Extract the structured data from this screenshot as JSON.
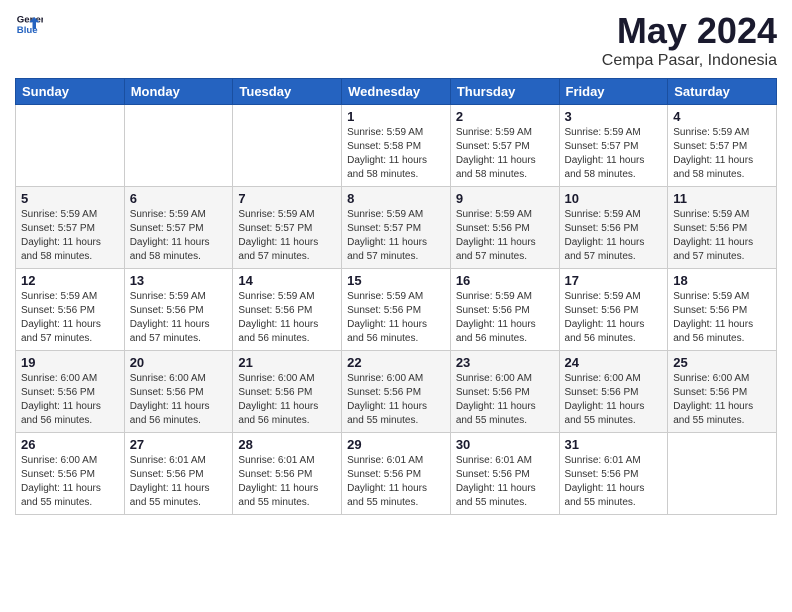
{
  "header": {
    "logo_line1": "General",
    "logo_line2": "Blue",
    "title": "May 2024",
    "subtitle": "Cempa Pasar, Indonesia"
  },
  "weekdays": [
    "Sunday",
    "Monday",
    "Tuesday",
    "Wednesday",
    "Thursday",
    "Friday",
    "Saturday"
  ],
  "weeks": [
    [
      {
        "day": "",
        "info": ""
      },
      {
        "day": "",
        "info": ""
      },
      {
        "day": "",
        "info": ""
      },
      {
        "day": "1",
        "info": "Sunrise: 5:59 AM\nSunset: 5:58 PM\nDaylight: 11 hours\nand 58 minutes."
      },
      {
        "day": "2",
        "info": "Sunrise: 5:59 AM\nSunset: 5:57 PM\nDaylight: 11 hours\nand 58 minutes."
      },
      {
        "day": "3",
        "info": "Sunrise: 5:59 AM\nSunset: 5:57 PM\nDaylight: 11 hours\nand 58 minutes."
      },
      {
        "day": "4",
        "info": "Sunrise: 5:59 AM\nSunset: 5:57 PM\nDaylight: 11 hours\nand 58 minutes."
      }
    ],
    [
      {
        "day": "5",
        "info": "Sunrise: 5:59 AM\nSunset: 5:57 PM\nDaylight: 11 hours\nand 58 minutes."
      },
      {
        "day": "6",
        "info": "Sunrise: 5:59 AM\nSunset: 5:57 PM\nDaylight: 11 hours\nand 58 minutes."
      },
      {
        "day": "7",
        "info": "Sunrise: 5:59 AM\nSunset: 5:57 PM\nDaylight: 11 hours\nand 57 minutes."
      },
      {
        "day": "8",
        "info": "Sunrise: 5:59 AM\nSunset: 5:57 PM\nDaylight: 11 hours\nand 57 minutes."
      },
      {
        "day": "9",
        "info": "Sunrise: 5:59 AM\nSunset: 5:56 PM\nDaylight: 11 hours\nand 57 minutes."
      },
      {
        "day": "10",
        "info": "Sunrise: 5:59 AM\nSunset: 5:56 PM\nDaylight: 11 hours\nand 57 minutes."
      },
      {
        "day": "11",
        "info": "Sunrise: 5:59 AM\nSunset: 5:56 PM\nDaylight: 11 hours\nand 57 minutes."
      }
    ],
    [
      {
        "day": "12",
        "info": "Sunrise: 5:59 AM\nSunset: 5:56 PM\nDaylight: 11 hours\nand 57 minutes."
      },
      {
        "day": "13",
        "info": "Sunrise: 5:59 AM\nSunset: 5:56 PM\nDaylight: 11 hours\nand 57 minutes."
      },
      {
        "day": "14",
        "info": "Sunrise: 5:59 AM\nSunset: 5:56 PM\nDaylight: 11 hours\nand 56 minutes."
      },
      {
        "day": "15",
        "info": "Sunrise: 5:59 AM\nSunset: 5:56 PM\nDaylight: 11 hours\nand 56 minutes."
      },
      {
        "day": "16",
        "info": "Sunrise: 5:59 AM\nSunset: 5:56 PM\nDaylight: 11 hours\nand 56 minutes."
      },
      {
        "day": "17",
        "info": "Sunrise: 5:59 AM\nSunset: 5:56 PM\nDaylight: 11 hours\nand 56 minutes."
      },
      {
        "day": "18",
        "info": "Sunrise: 5:59 AM\nSunset: 5:56 PM\nDaylight: 11 hours\nand 56 minutes."
      }
    ],
    [
      {
        "day": "19",
        "info": "Sunrise: 6:00 AM\nSunset: 5:56 PM\nDaylight: 11 hours\nand 56 minutes."
      },
      {
        "day": "20",
        "info": "Sunrise: 6:00 AM\nSunset: 5:56 PM\nDaylight: 11 hours\nand 56 minutes."
      },
      {
        "day": "21",
        "info": "Sunrise: 6:00 AM\nSunset: 5:56 PM\nDaylight: 11 hours\nand 56 minutes."
      },
      {
        "day": "22",
        "info": "Sunrise: 6:00 AM\nSunset: 5:56 PM\nDaylight: 11 hours\nand 55 minutes."
      },
      {
        "day": "23",
        "info": "Sunrise: 6:00 AM\nSunset: 5:56 PM\nDaylight: 11 hours\nand 55 minutes."
      },
      {
        "day": "24",
        "info": "Sunrise: 6:00 AM\nSunset: 5:56 PM\nDaylight: 11 hours\nand 55 minutes."
      },
      {
        "day": "25",
        "info": "Sunrise: 6:00 AM\nSunset: 5:56 PM\nDaylight: 11 hours\nand 55 minutes."
      }
    ],
    [
      {
        "day": "26",
        "info": "Sunrise: 6:00 AM\nSunset: 5:56 PM\nDaylight: 11 hours\nand 55 minutes."
      },
      {
        "day": "27",
        "info": "Sunrise: 6:01 AM\nSunset: 5:56 PM\nDaylight: 11 hours\nand 55 minutes."
      },
      {
        "day": "28",
        "info": "Sunrise: 6:01 AM\nSunset: 5:56 PM\nDaylight: 11 hours\nand 55 minutes."
      },
      {
        "day": "29",
        "info": "Sunrise: 6:01 AM\nSunset: 5:56 PM\nDaylight: 11 hours\nand 55 minutes."
      },
      {
        "day": "30",
        "info": "Sunrise: 6:01 AM\nSunset: 5:56 PM\nDaylight: 11 hours\nand 55 minutes."
      },
      {
        "day": "31",
        "info": "Sunrise: 6:01 AM\nSunset: 5:56 PM\nDaylight: 11 hours\nand 55 minutes."
      },
      {
        "day": "",
        "info": ""
      }
    ]
  ]
}
